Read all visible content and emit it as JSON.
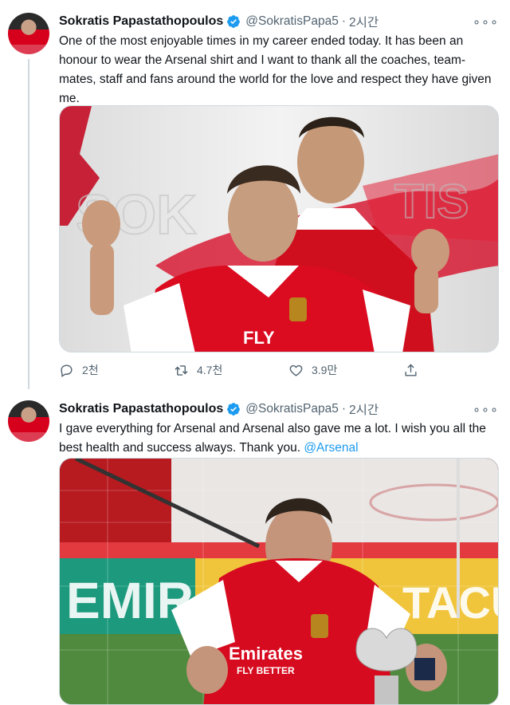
{
  "tweets": [
    {
      "author_name": "Sokratis Papastathopoulos",
      "handle": "@SokratisPapa5",
      "separator": "·",
      "time": "2시간",
      "more": "∘∘∘",
      "text": "One of the most enjoyable times in my career ended today. It has been an honour to wear the Arsenal shirt and I want to thank all the coaches, team-mates, staff and fans around the world for the love and respect they have given me.",
      "image_text": "FLY",
      "actions": {
        "reply_count": "2천",
        "retweet_count": "4.7천",
        "like_count": "3.9만"
      }
    },
    {
      "author_name": "Sokratis Papastathopoulos",
      "handle": "@SokratisPapa5",
      "separator": "·",
      "time": "2시간",
      "more": "∘∘∘",
      "text": "I gave everything for Arsenal and Arsenal also gave me a lot. I wish you all the best health and success always. Thank you.",
      "mention": "@Arsenal",
      "image_text": {
        "banner_left": "EMIR",
        "banner_right": "TACU",
        "shirt_sponsor": "Emirates",
        "shirt_tagline": "FLY BETTER"
      }
    }
  ],
  "colors": {
    "accent": "#1d9bf0",
    "arsenal_red": "#d6001c",
    "muted": "#536471"
  },
  "icons": [
    "verified-badge-icon",
    "more-icon",
    "reply-icon",
    "retweet-icon",
    "like-icon",
    "share-icon"
  ]
}
